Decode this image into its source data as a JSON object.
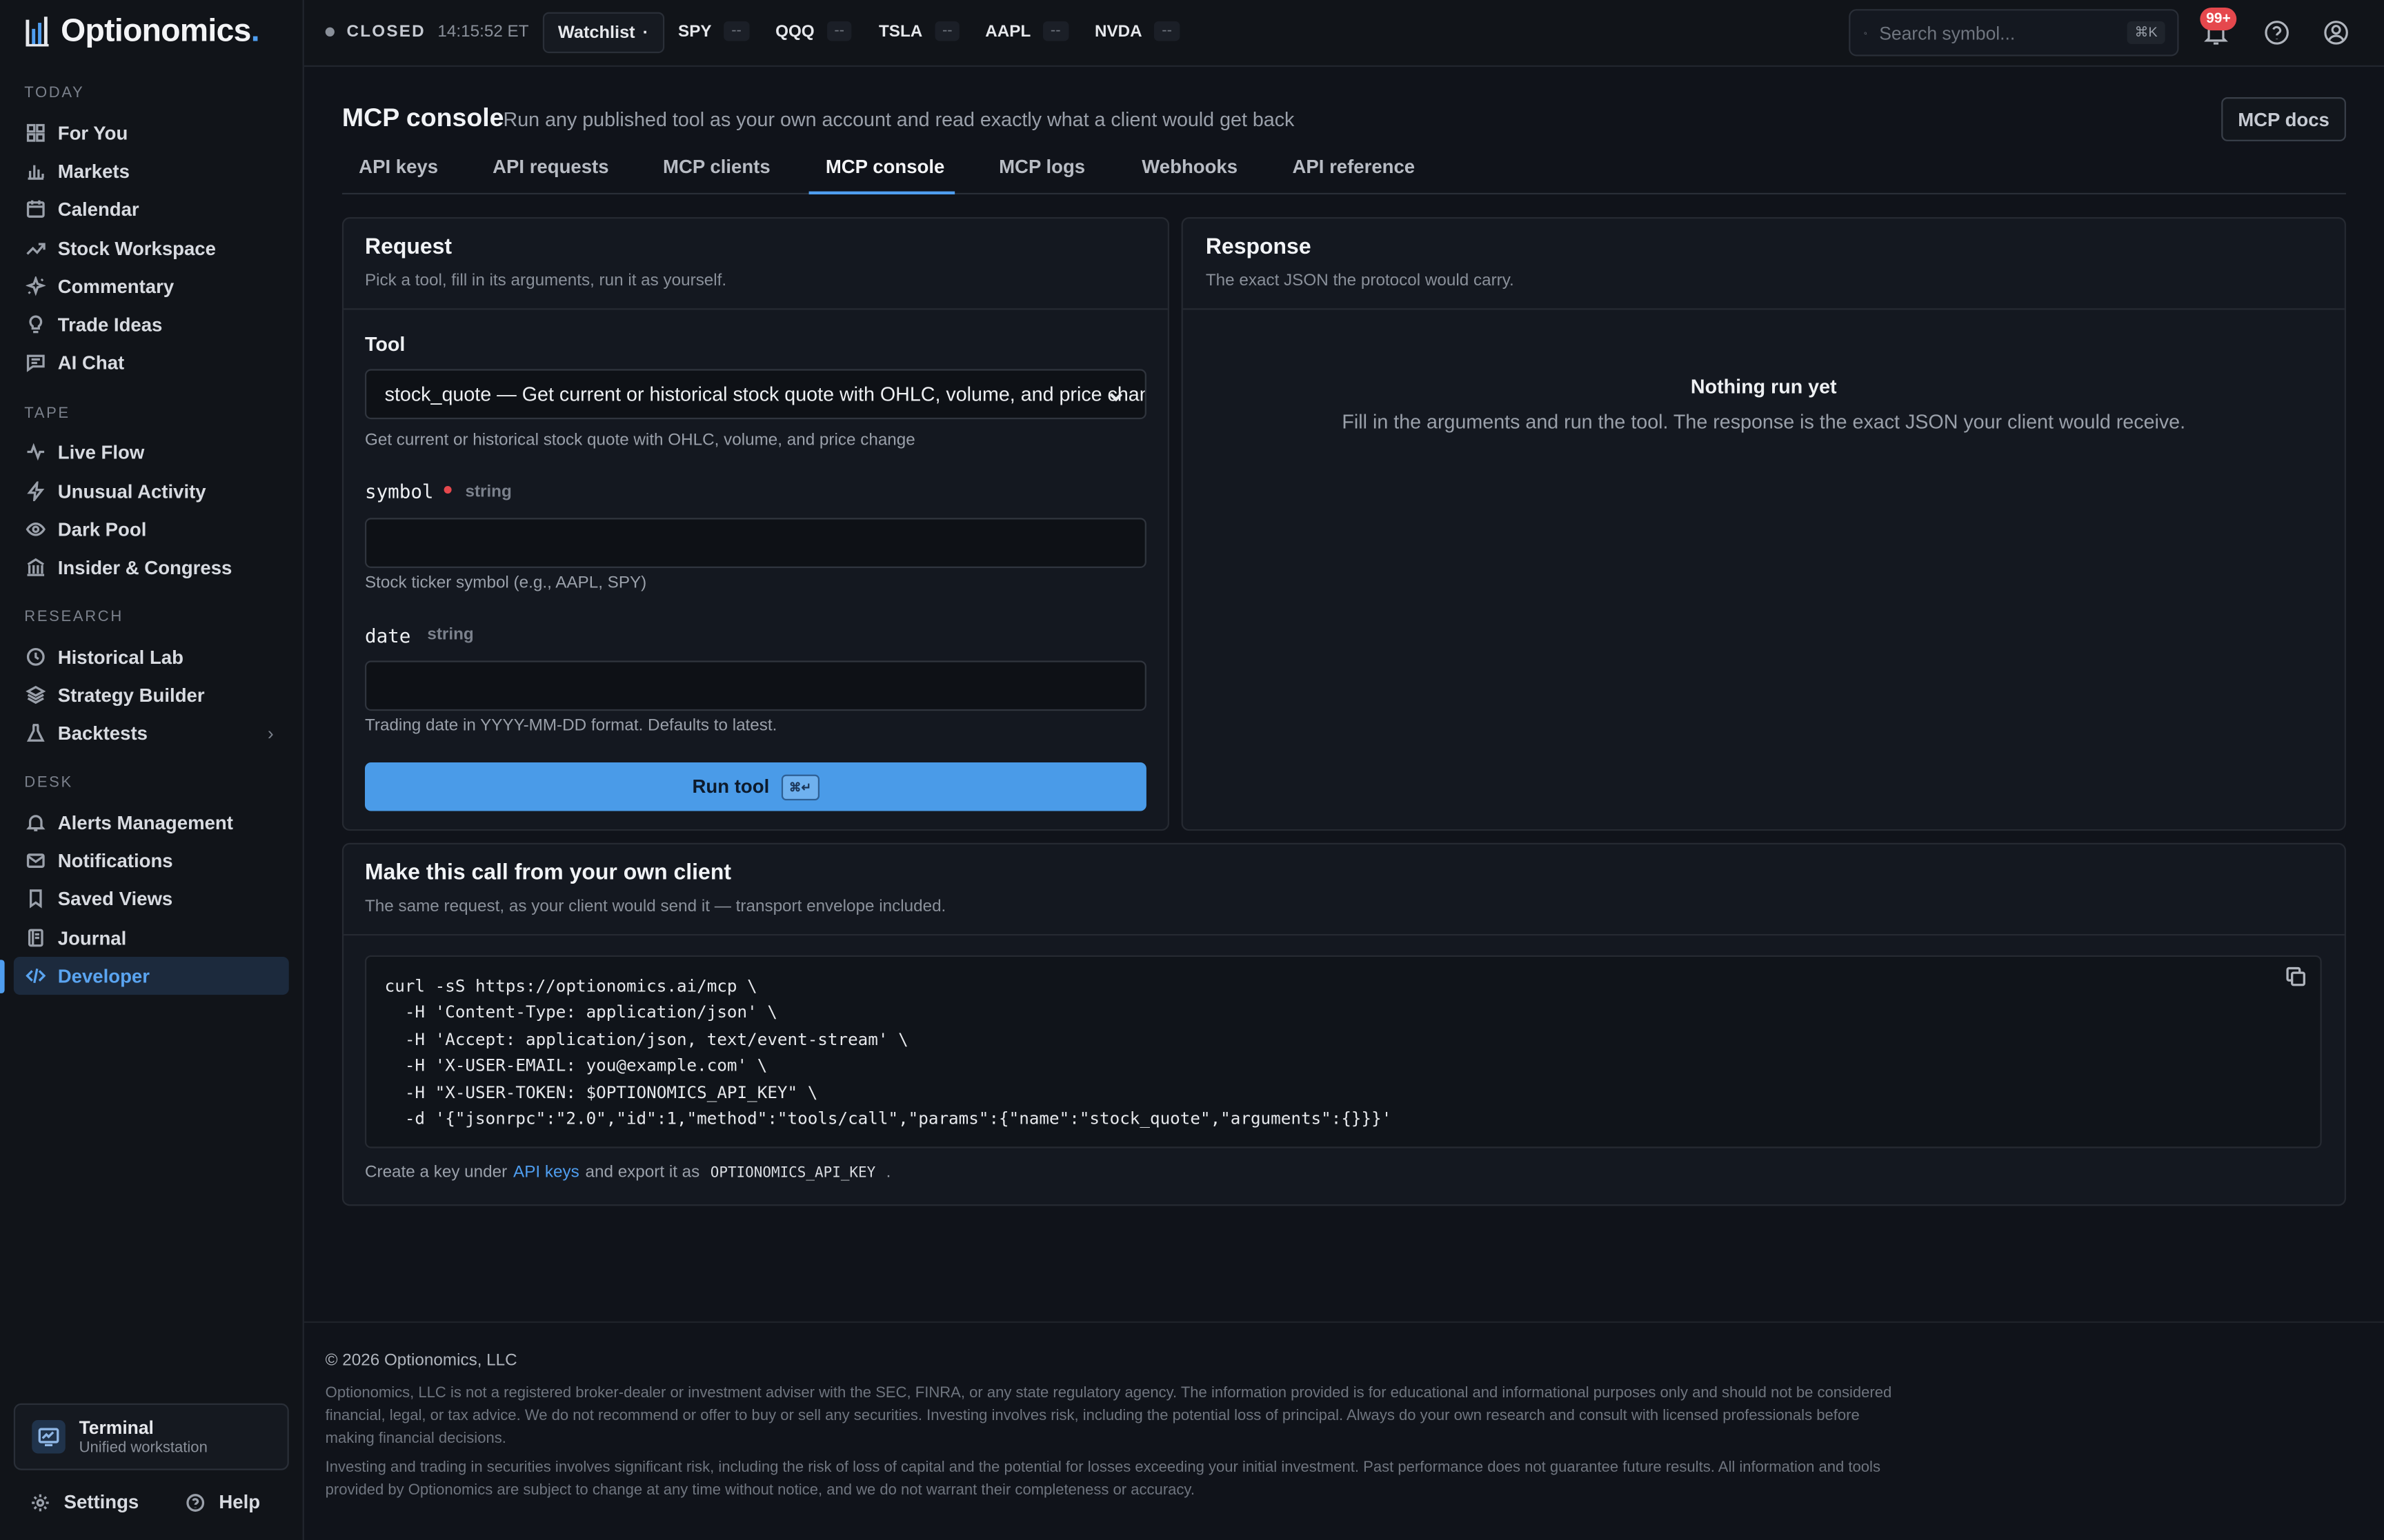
{
  "brand": {
    "name": "Optionomics",
    "dot": ".",
    "accent": "#4f9ef0"
  },
  "sidebar": {
    "sections": [
      {
        "title": "TODAY",
        "items": [
          {
            "label": "For You",
            "icon": "grid-icon"
          },
          {
            "label": "Markets",
            "icon": "bar-chart-icon"
          },
          {
            "label": "Calendar",
            "icon": "calendar-icon"
          },
          {
            "label": "Stock Workspace",
            "icon": "trending-up-icon"
          },
          {
            "label": "Commentary",
            "icon": "sparkle-icon"
          },
          {
            "label": "Trade Ideas",
            "icon": "lightbulb-icon"
          },
          {
            "label": "AI Chat",
            "icon": "chat-icon"
          }
        ]
      },
      {
        "title": "TAPE",
        "items": [
          {
            "label": "Live Flow",
            "icon": "pulse-icon"
          },
          {
            "label": "Unusual Activity",
            "icon": "lightning-icon"
          },
          {
            "label": "Dark Pool",
            "icon": "eye-icon"
          },
          {
            "label": "Insider & Congress",
            "icon": "building-icon"
          }
        ]
      },
      {
        "title": "RESEARCH",
        "items": [
          {
            "label": "Historical Lab",
            "icon": "clock-icon"
          },
          {
            "label": "Strategy Builder",
            "icon": "layers-icon"
          },
          {
            "label": "Backtests",
            "icon": "flask-icon"
          }
        ]
      },
      {
        "title": "DESK",
        "items": [
          {
            "label": "Alerts Management",
            "icon": "bell-icon"
          },
          {
            "label": "Notifications",
            "icon": "mail-icon"
          },
          {
            "label": "Saved Views",
            "icon": "bookmark-icon"
          },
          {
            "label": "Journal",
            "icon": "book-icon"
          },
          {
            "label": "Developer",
            "icon": "code-icon",
            "active": true
          }
        ]
      }
    ],
    "terminal": {
      "title": "Terminal",
      "subtitle": "Unified workstation"
    },
    "footer": {
      "settings": "Settings",
      "help": "Help"
    }
  },
  "topbar": {
    "market_status": "CLOSED",
    "market_time": "14:15:52 ET",
    "watchlist_label": "Watchlist",
    "watchlist_caret": "·",
    "tickers": [
      {
        "symbol": "SPY",
        "value": "--"
      },
      {
        "symbol": "QQQ",
        "value": "--"
      },
      {
        "symbol": "TSLA",
        "value": "--"
      },
      {
        "symbol": "AAPL",
        "value": "--"
      },
      {
        "symbol": "NVDA",
        "value": "--"
      }
    ],
    "search_placeholder": "Search symbol...",
    "search_shortcut": "⌘K",
    "notification_badge": "99+"
  },
  "header": {
    "title": "MCP console",
    "subtitle": "Run any published tool as your own account and read exactly what a client would get back",
    "docs_button": "MCP docs"
  },
  "tabs": [
    {
      "label": "API keys"
    },
    {
      "label": "API requests"
    },
    {
      "label": "MCP clients"
    },
    {
      "label": "MCP console",
      "active": true
    },
    {
      "label": "MCP logs"
    },
    {
      "label": "Webhooks"
    },
    {
      "label": "API reference"
    }
  ],
  "request": {
    "title": "Request",
    "subtitle": "Pick a tool, fill in its arguments, run it as yourself.",
    "tool_label": "Tool",
    "tool_selected": "stock_quote — Get current or historical stock quote with OHLC, volume, and price change",
    "tool_description": "Get current or historical stock quote with OHLC, volume, and price change",
    "fields": [
      {
        "name": "symbol",
        "type": "string",
        "required": true,
        "value": "",
        "help": "Stock ticker symbol (e.g., AAPL, SPY)"
      },
      {
        "name": "date",
        "type": "string",
        "required": false,
        "value": "",
        "help": "Trading date in YYYY-MM-DD format. Defaults to latest."
      }
    ],
    "run_label": "Run tool",
    "run_shortcut": "⌘↵"
  },
  "response": {
    "title": "Response",
    "subtitle": "The exact JSON the protocol would carry.",
    "empty_title": "Nothing run yet",
    "empty_sub": "Fill in the arguments and run the tool. The response is the exact JSON your client would receive."
  },
  "client_call": {
    "title": "Make this call from your own client",
    "subtitle": "The same request, as your client would send it — transport envelope included.",
    "code_lines": [
      "curl -sS https://optionomics.ai/mcp \\",
      "  -H 'Content-Type: application/json' \\",
      "  -H 'Accept: application/json, text/event-stream' \\",
      "  -H 'X-USER-EMAIL: you@example.com' \\",
      "  -H \"X-USER-TOKEN: $OPTIONOMICS_API_KEY\" \\",
      "  -d '{\"jsonrpc\":\"2.0\",\"id\":1,\"method\":\"tools/call\",\"params\":{\"name\":\"stock_quote\",\"arguments\":{}}}'"
    ],
    "note_prefix": "Create a key under",
    "note_link": "API keys",
    "note_middle": "and export it as",
    "note_code": "OPTIONOMICS_API_KEY",
    "note_suffix": "."
  },
  "footer": {
    "copyright": "© 2026 Optionomics, LLC",
    "disclaimer_1": "Optionomics, LLC is not a registered broker-dealer or investment adviser with the SEC, FINRA, or any state regulatory agency. The information provided is for educational and informational purposes only and should not be considered financial, legal, or tax advice. We do not recommend or offer to buy or sell any securities. Investing involves risk, including the potential loss of principal. Always do your own research and consult with licensed professionals before making financial decisions.",
    "disclaimer_2": "Investing and trading in securities involves significant risk, including the risk of loss of capital and the potential for losses exceeding your initial investment. Past performance does not guarantee future results. All information and tools provided by Optionomics are subject to change at any time without notice, and we do not warrant their completeness or accuracy."
  }
}
